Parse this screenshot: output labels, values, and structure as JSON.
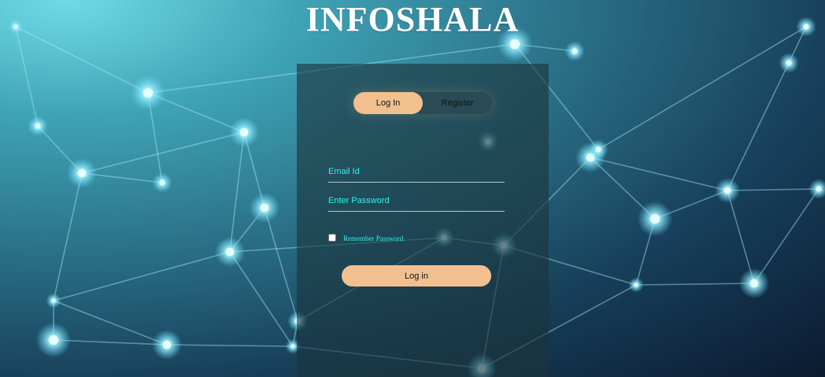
{
  "app": {
    "title": "INFOSHALA"
  },
  "auth_tabs": {
    "login_label": "Log In",
    "register_label": "Register",
    "active": "Log In"
  },
  "form": {
    "email_placeholder": "Email Id",
    "password_placeholder": "Enter Password",
    "remember_label": "Remember Password",
    "remember_checked": false,
    "submit_label": "Log in"
  },
  "colors": {
    "accent": "#f2c08f",
    "input_text": "#2ef3f0",
    "panel_bg": "#1c343c"
  }
}
